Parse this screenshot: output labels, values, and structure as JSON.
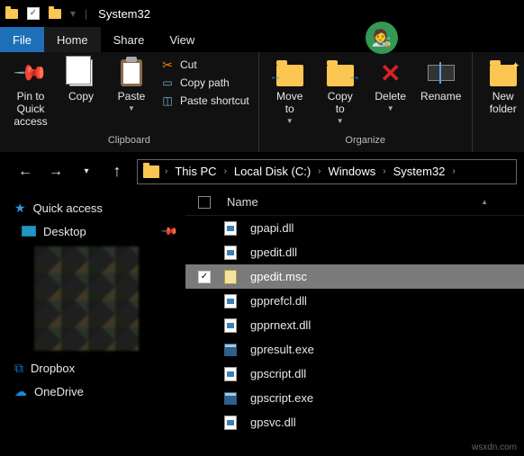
{
  "title": "System32",
  "tabs": {
    "file": "File",
    "home": "Home",
    "share": "Share",
    "view": "View"
  },
  "ribbon": {
    "pin": "Pin to Quick\naccess",
    "copy": "Copy",
    "paste": "Paste",
    "cut": "Cut",
    "copy_path": "Copy path",
    "paste_shortcut": "Paste shortcut",
    "clipboard_group": "Clipboard",
    "move_to": "Move\nto",
    "copy_to": "Copy\nto",
    "delete": "Delete",
    "rename": "Rename",
    "organize_group": "Organize",
    "new_folder": "New\nfolder"
  },
  "breadcrumbs": [
    "This PC",
    "Local Disk (C:)",
    "Windows",
    "System32"
  ],
  "sidebar": {
    "quick_access": "Quick access",
    "desktop": "Desktop",
    "dropbox": "Dropbox",
    "onedrive": "OneDrive"
  },
  "list": {
    "header": "Name",
    "files": [
      {
        "name": "gpapi.dll",
        "type": "dll",
        "selected": false
      },
      {
        "name": "gpedit.dll",
        "type": "dll",
        "selected": false
      },
      {
        "name": "gpedit.msc",
        "type": "msc",
        "selected": true
      },
      {
        "name": "gpprefcl.dll",
        "type": "dll",
        "selected": false
      },
      {
        "name": "gpprnext.dll",
        "type": "dll",
        "selected": false
      },
      {
        "name": "gpresult.exe",
        "type": "exe",
        "selected": false
      },
      {
        "name": "gpscript.dll",
        "type": "dll",
        "selected": false
      },
      {
        "name": "gpscript.exe",
        "type": "exe",
        "selected": false
      },
      {
        "name": "gpsvc.dll",
        "type": "dll",
        "selected": false
      }
    ]
  },
  "watermark": "wsxdn.com"
}
